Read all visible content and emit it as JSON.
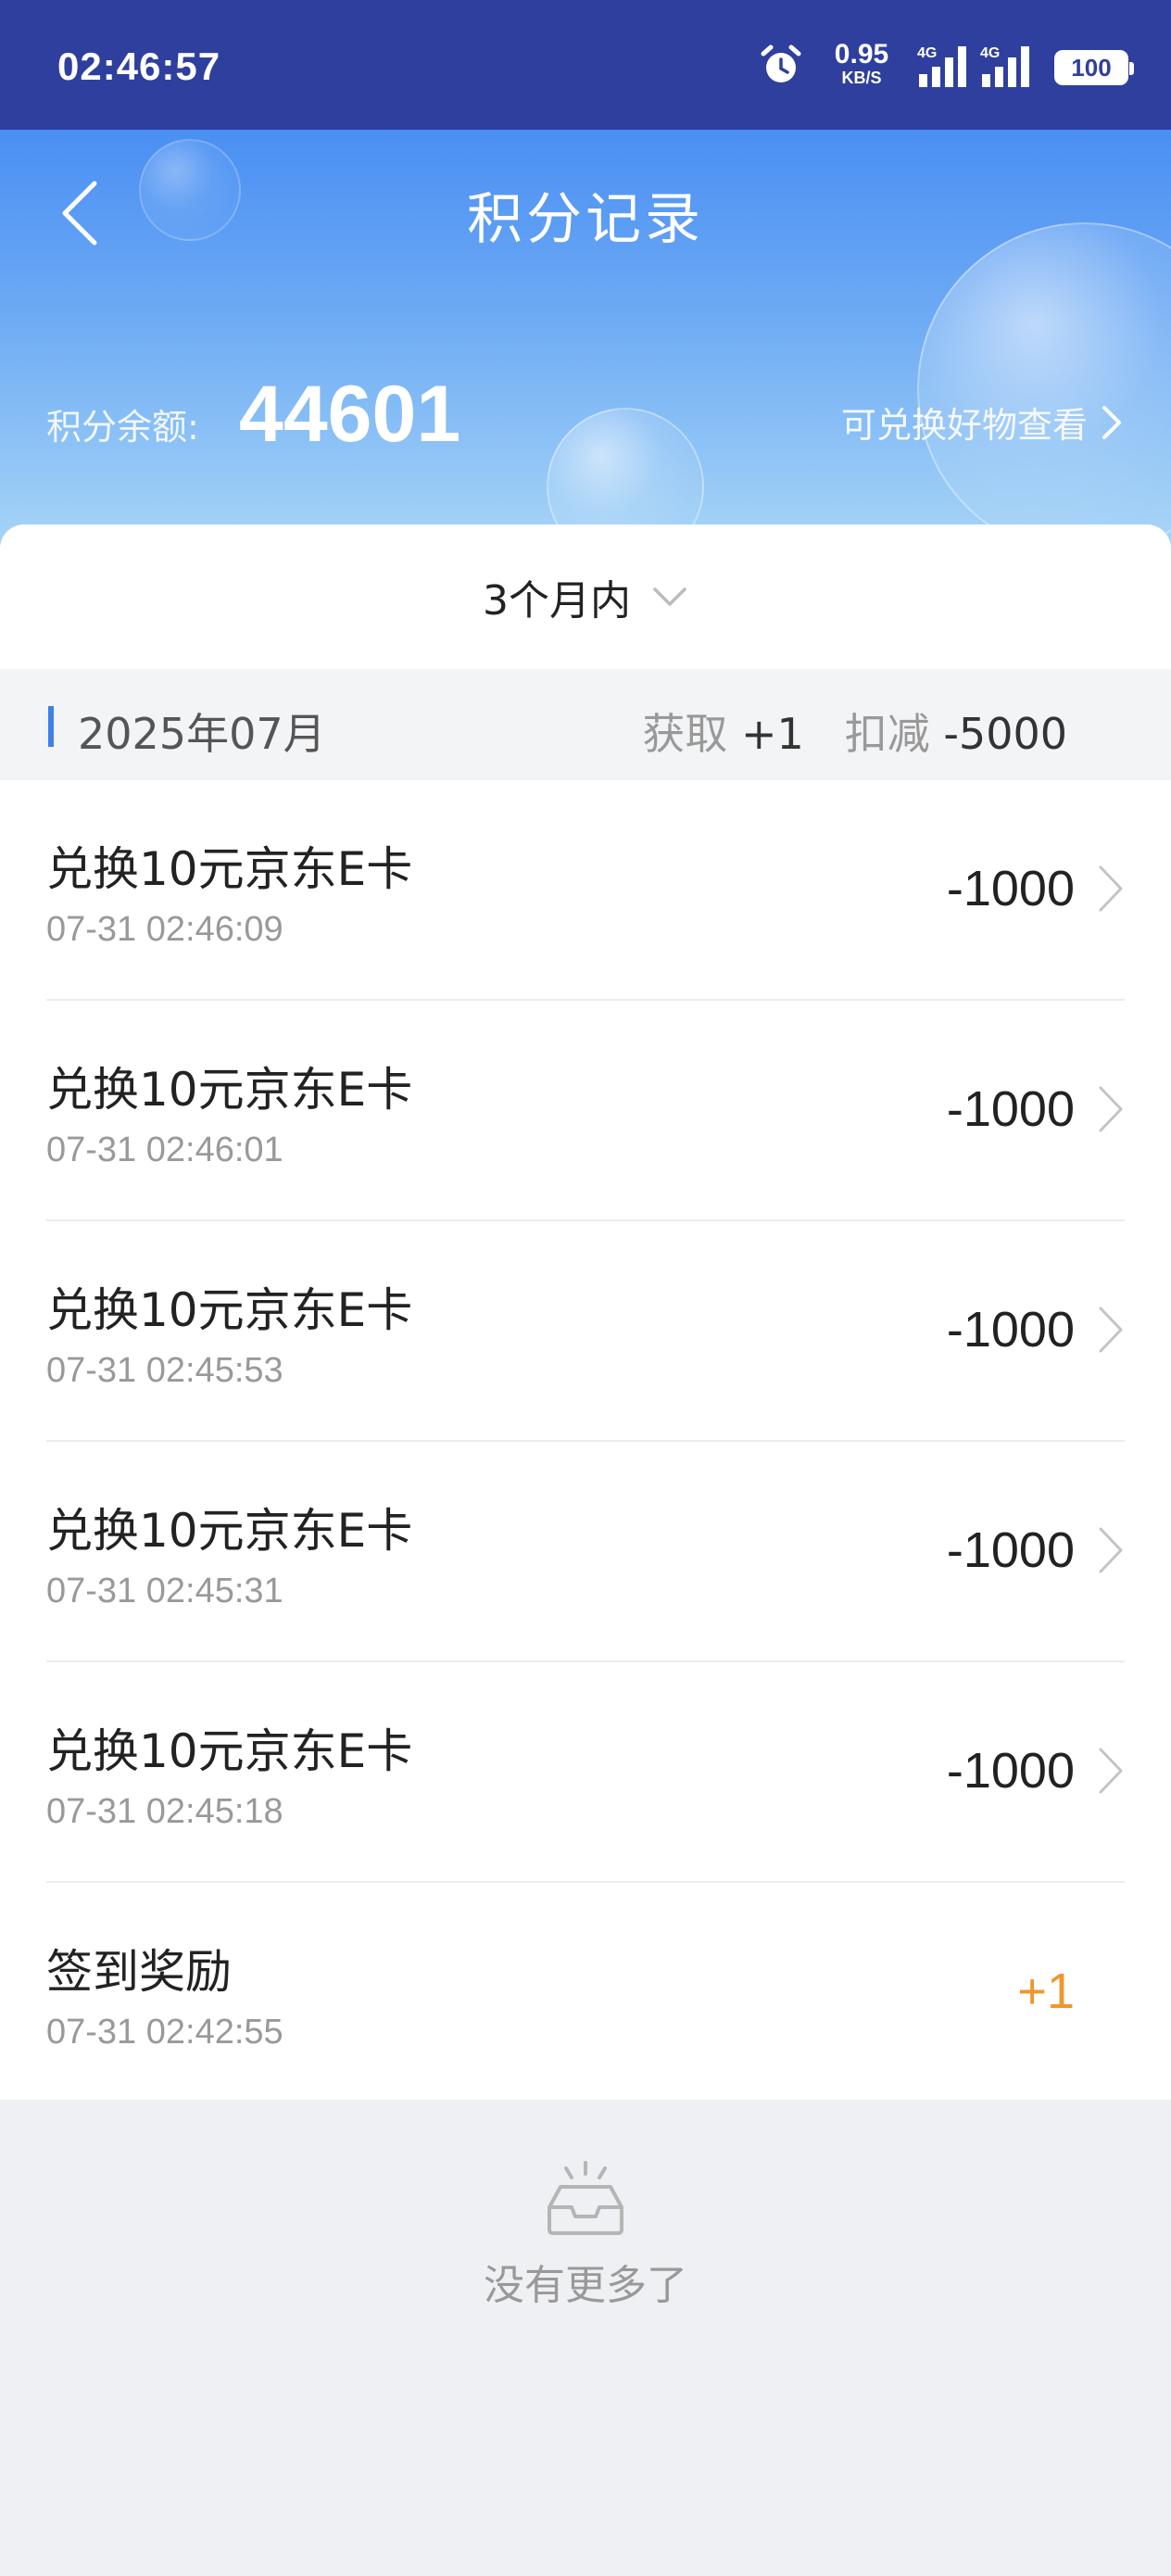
{
  "status_bar": {
    "time": "02:46:57",
    "net_speed_value": "0.95",
    "net_speed_unit": "KB/S",
    "signal1_label": "4G",
    "signal2_label": "4G",
    "battery": "100",
    "icons": [
      "alarm-icon",
      "signal-icon",
      "signal-icon",
      "battery-icon"
    ]
  },
  "header": {
    "title": "积分记录",
    "balance_label": "积分余额:",
    "balance_value": "44601",
    "redeem_link": "可兑换好物查看",
    "colors": {
      "gradient_top": "#4a8ff3",
      "gradient_bottom": "#a9d6f6"
    }
  },
  "filter": {
    "label": "3个月内"
  },
  "month_group": {
    "month": "2025年07月",
    "earn_label": "获取",
    "earn_value": "+1",
    "deduct_label": "扣减",
    "deduct_value": "-5000"
  },
  "records": [
    {
      "title": "兑换10元京东E卡",
      "time": "07-31 02:46:09",
      "amount": "-1000"
    },
    {
      "title": "兑换10元京东E卡",
      "time": "07-31 02:46:01",
      "amount": "-1000"
    },
    {
      "title": "兑换10元京东E卡",
      "time": "07-31 02:45:53",
      "amount": "-1000"
    },
    {
      "title": "兑换10元京东E卡",
      "time": "07-31 02:45:31",
      "amount": "-1000"
    },
    {
      "title": "兑换10元京东E卡",
      "time": "07-31 02:45:18",
      "amount": "-1000"
    },
    {
      "title": "签到奖励",
      "time": "07-31 02:42:55",
      "amount": "+1"
    }
  ],
  "footer": {
    "no_more_text": "没有更多了"
  },
  "colors": {
    "accent": "#3f7fe8",
    "positive_amount": "#f0962c",
    "status_bar_bg": "#2f3f9e"
  }
}
